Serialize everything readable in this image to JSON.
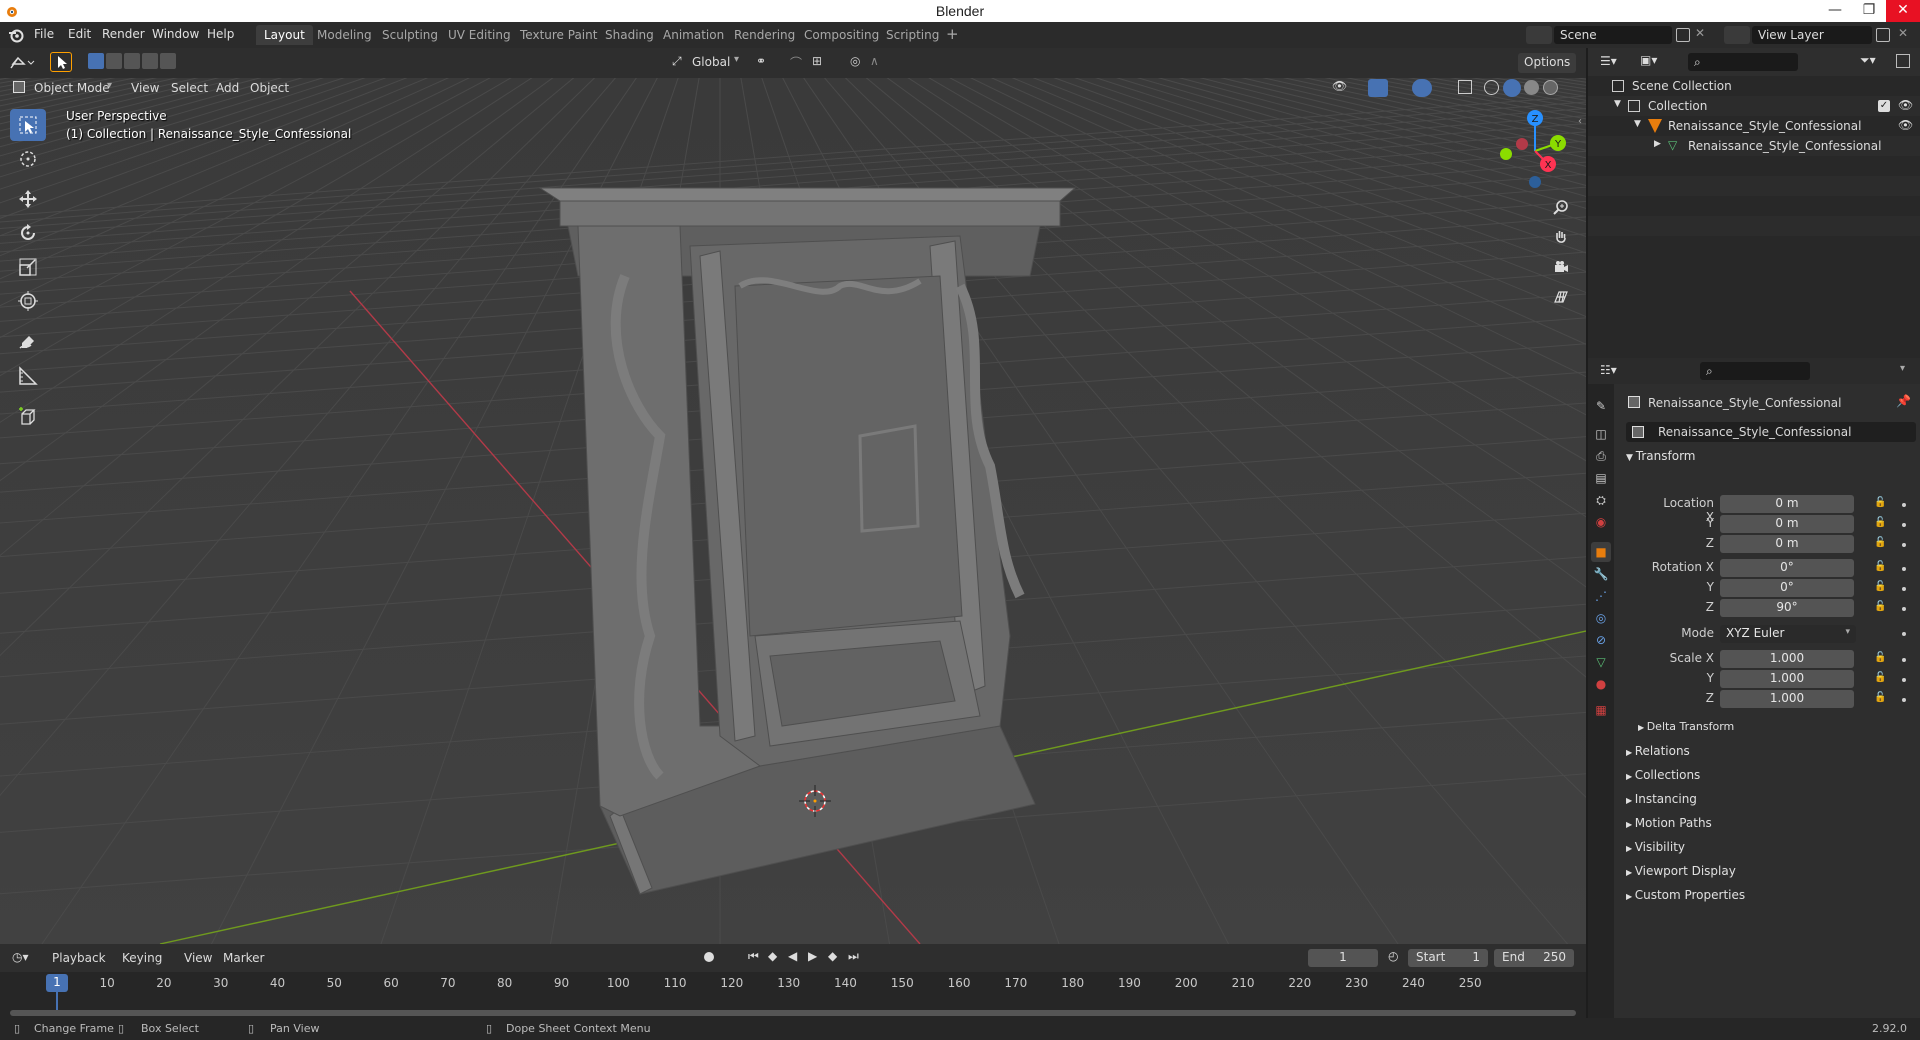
{
  "window": {
    "title": "Blender",
    "minimize": "—",
    "restore": "❐",
    "close": "✕"
  },
  "menu": [
    "File",
    "Edit",
    "Render",
    "Window",
    "Help"
  ],
  "workspaces": [
    "Layout",
    "Modeling",
    "Sculpting",
    "UV Editing",
    "Texture Paint",
    "Shading",
    "Animation",
    "Rendering",
    "Compositing",
    "Scripting"
  ],
  "active_workspace": "Layout",
  "add_workspace": "+",
  "scene": {
    "name": "Scene",
    "view_layer": "View Layer"
  },
  "viewport_header": {
    "mode": "Object Mode",
    "menus": [
      "View",
      "Select",
      "Add",
      "Object"
    ],
    "orientation": "Global",
    "options": "Options"
  },
  "viewport_overlay": {
    "perspective": "User Perspective",
    "collection_info": "(1) Collection | Renaissance_Style_Confessional"
  },
  "gizmo": {
    "x": "X",
    "y": "Y",
    "z": "Z"
  },
  "outliner": {
    "rows": [
      {
        "label": "Scene Collection",
        "type": "scene-collection"
      },
      {
        "label": "Collection",
        "type": "collection"
      },
      {
        "label": "Renaissance_Style_Confessional",
        "type": "object"
      },
      {
        "label": "Renaissance_Style_Confessional",
        "type": "mesh-data"
      }
    ]
  },
  "properties": {
    "object_name": "Renaissance_Style_Confessional",
    "object_field": "Renaissance_Style_Confessional",
    "transform_header": "Transform",
    "location_label": "Location X",
    "rotation_label": "Rotation X",
    "scale_label": "Scale X",
    "y_label": "Y",
    "z_label": "Z",
    "location": [
      "0 m",
      "0 m",
      "0 m"
    ],
    "rotation": [
      "0°",
      "0°",
      "90°"
    ],
    "mode_label": "Mode",
    "mode_value": "XYZ Euler",
    "scale": [
      "1.000",
      "1.000",
      "1.000"
    ],
    "delta_transform": "Delta Transform",
    "panels": [
      "Relations",
      "Collections",
      "Instancing",
      "Motion Paths",
      "Visibility",
      "Viewport Display",
      "Custom Properties"
    ]
  },
  "timeline": {
    "menus": [
      "Playback",
      "Keying",
      "View",
      "Marker"
    ],
    "current_frame": "1",
    "start_label": "Start",
    "start": "1",
    "end_label": "End",
    "end": "250",
    "ticks": [
      "1",
      "10",
      "20",
      "30",
      "40",
      "50",
      "60",
      "70",
      "80",
      "90",
      "100",
      "110",
      "120",
      "130",
      "140",
      "150",
      "160",
      "170",
      "180",
      "190",
      "200",
      "210",
      "220",
      "230",
      "240",
      "250"
    ]
  },
  "statusbar": {
    "change_frame": "Change Frame",
    "box_select": "Box Select",
    "pan_view": "Pan View",
    "context_menu": "Dope Sheet Context Menu",
    "version": "2.92.0"
  },
  "colors": {
    "accent": "#4772b3",
    "x_axis": "#ff3352",
    "y_axis": "#8bdc00",
    "z_axis": "#2890ff",
    "viewport_bg": "#3d3d3d",
    "selection": "#ffa000"
  }
}
